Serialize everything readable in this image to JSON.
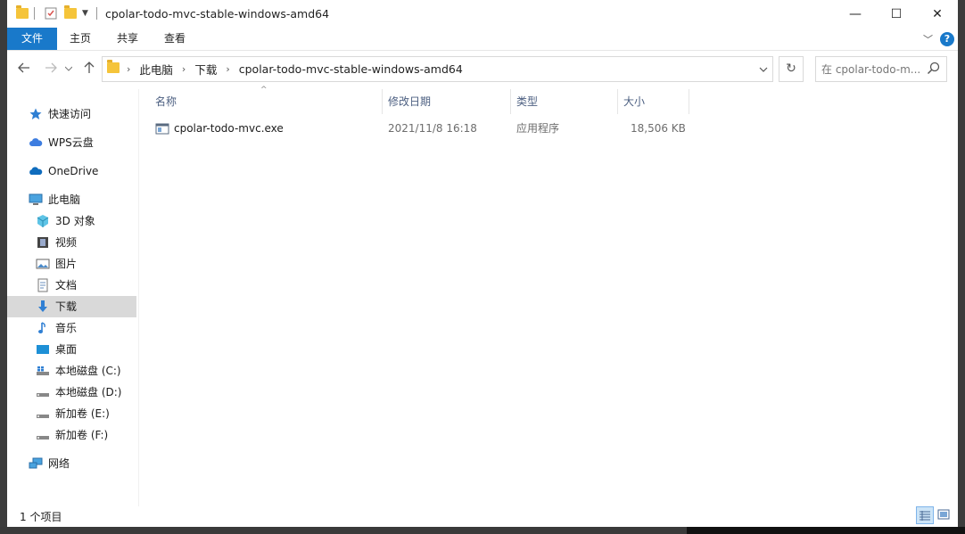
{
  "window": {
    "title": "cpolar-todo-mvc-stable-windows-amd64",
    "controls": {
      "minimize": "—",
      "maximize": "☐",
      "close": "✕"
    }
  },
  "ribbon": {
    "tabs": [
      {
        "label": "文件",
        "active": true
      },
      {
        "label": "主页",
        "active": false
      },
      {
        "label": "共享",
        "active": false
      },
      {
        "label": "查看",
        "active": false
      }
    ],
    "help": "?",
    "expand_icon": "chevron-down-icon"
  },
  "address": {
    "breadcrumbs": [
      "此电脑",
      "下载",
      "cpolar-todo-mvc-stable-windows-amd64"
    ],
    "search_placeholder": "在 cpolar-todo-m..."
  },
  "nav": {
    "items": [
      {
        "label": "快速访问",
        "icon": "star-icon"
      },
      {
        "label": "WPS云盘",
        "icon": "cloud-icon"
      },
      {
        "label": "OneDrive",
        "icon": "onedrive-icon"
      },
      {
        "label": "此电脑",
        "icon": "computer-icon"
      },
      {
        "label": "3D 对象",
        "icon": "cube-icon"
      },
      {
        "label": "视频",
        "icon": "video-icon"
      },
      {
        "label": "图片",
        "icon": "picture-icon"
      },
      {
        "label": "文档",
        "icon": "document-icon"
      },
      {
        "label": "下载",
        "icon": "download-icon",
        "selected": true
      },
      {
        "label": "音乐",
        "icon": "music-icon"
      },
      {
        "label": "桌面",
        "icon": "desktop-icon"
      },
      {
        "label": "本地磁盘 (C:)",
        "icon": "drive-c-icon"
      },
      {
        "label": "本地磁盘 (D:)",
        "icon": "drive-icon"
      },
      {
        "label": "新加卷 (E:)",
        "icon": "drive-icon"
      },
      {
        "label": "新加卷 (F:)",
        "icon": "drive-icon"
      },
      {
        "label": "网络",
        "icon": "network-icon"
      }
    ]
  },
  "files": {
    "columns": [
      "名称",
      "修改日期",
      "类型",
      "大小"
    ],
    "rows": [
      {
        "name": "cpolar-todo-mvc.exe",
        "modified": "2021/11/8 16:18",
        "type": "应用程序",
        "size": "18,506 KB"
      }
    ]
  },
  "status": {
    "item_count": "1 个项目"
  },
  "colors": {
    "accent": "#1979ca",
    "folder": "#f5c43a",
    "selected_row": "#d9d9d9",
    "column_header": "#4d6082"
  }
}
